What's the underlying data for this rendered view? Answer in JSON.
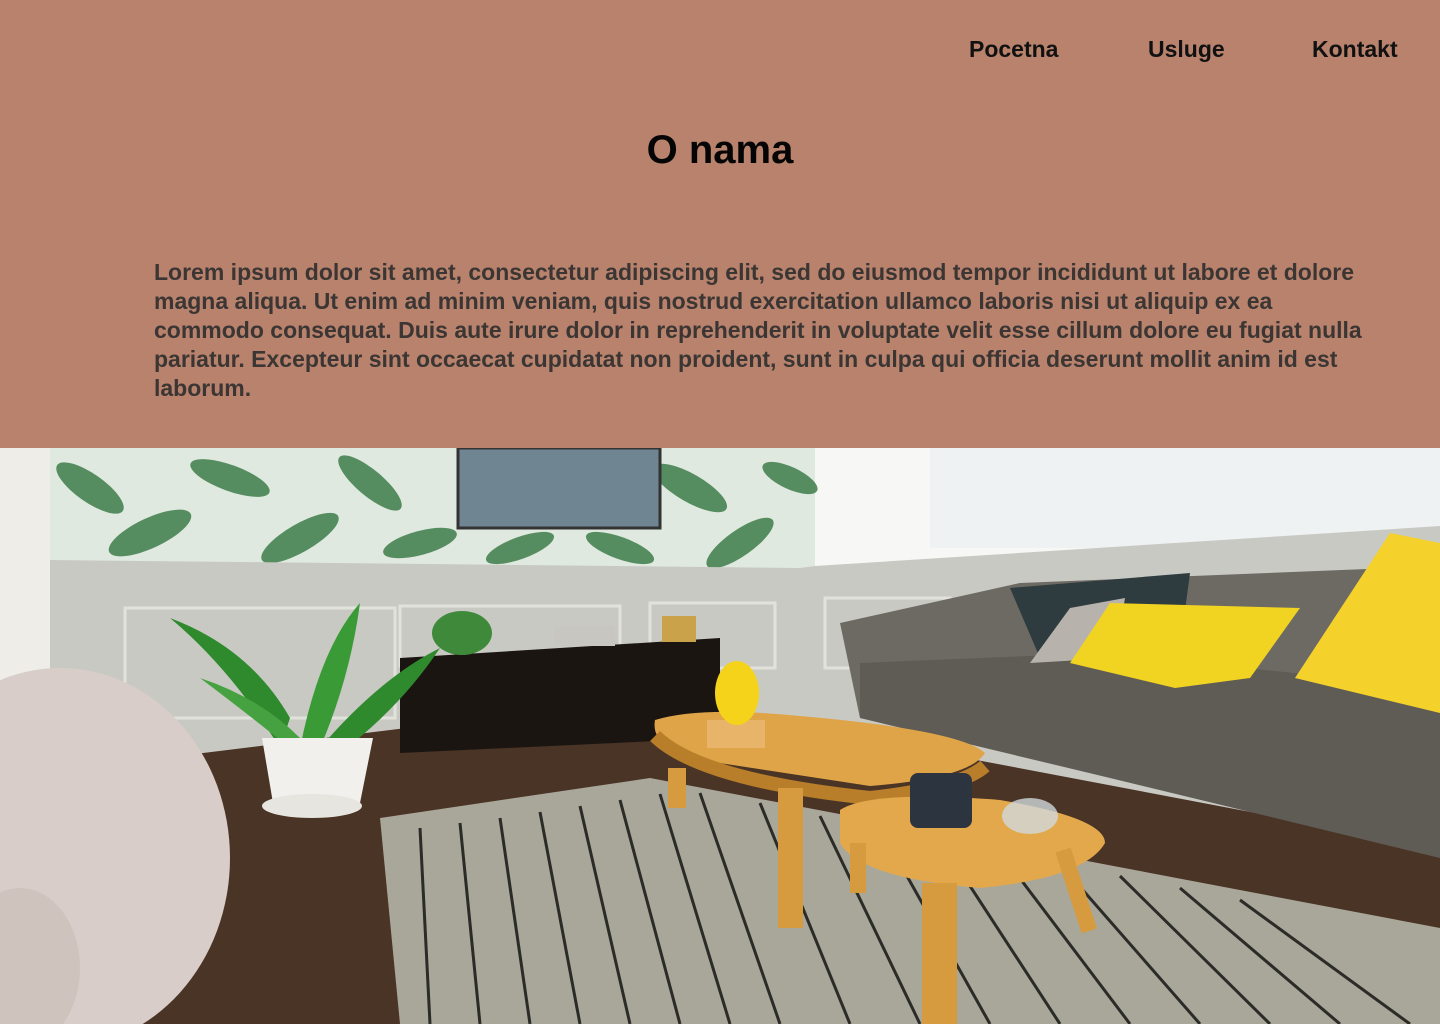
{
  "nav": {
    "items": [
      "Pocetna",
      "Usluge",
      "Kontakt"
    ]
  },
  "hero": {
    "title": "O nama",
    "body": "Lorem ipsum dolor sit amet, consectetur adipiscing elit, sed do eiusmod tempor incididunt ut labore et dolore magna aliqua. Ut enim ad minim veniam, quis nostrud exercitation ullamco laboris nisi ut aliquip ex ea commodo consequat. Duis aute irure dolor in reprehenderit in voluptate velit esse cillum dolore eu fugiat nulla pariatur. Excepteur sint occaecat cupidatat non proident, sunt in culpa qui officia deserunt mollit anim id est laborum."
  },
  "image": {
    "subject": "living-room-photo"
  },
  "colors": {
    "background": "#b8826d",
    "text": "#111111",
    "body_text": "#3b3633"
  }
}
